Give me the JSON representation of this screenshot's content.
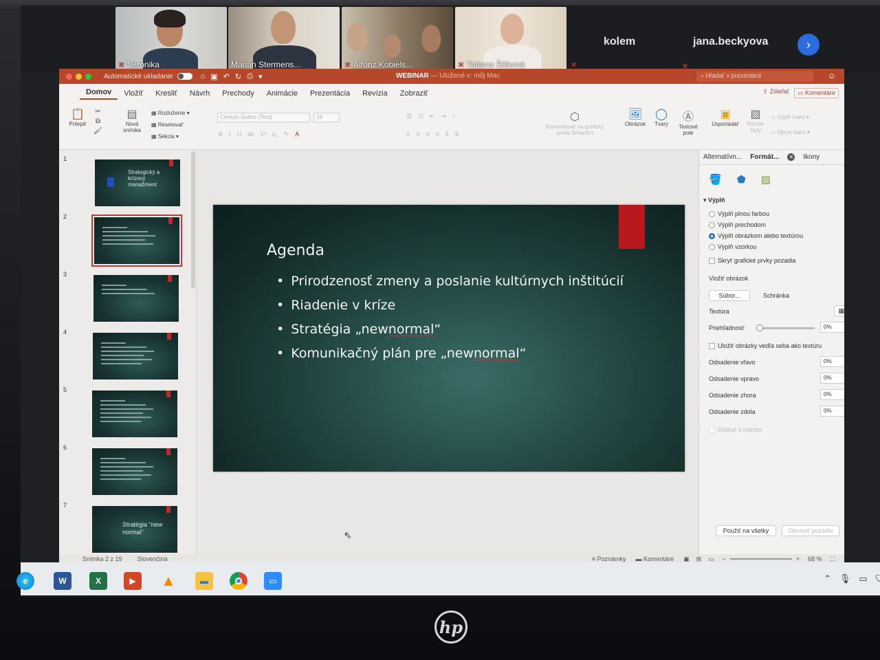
{
  "zoom": {
    "participants": [
      {
        "name": "Veronika",
        "muted": true
      },
      {
        "name": "Marian Stermens...",
        "muted": false
      },
      {
        "name": "Alfonz Kobiels...",
        "muted": true
      },
      {
        "name": "Tatiana Šišková",
        "muted": true
      }
    ],
    "name_only": [
      "kolem",
      "jana.beckyova"
    ],
    "next_icon": "chevron-right-icon",
    "mic_off_icon": "mic-off-icon"
  },
  "ppt": {
    "titlebar": {
      "autosave": "Automatické ukladanie",
      "doc_name": "WEBINAR",
      "doc_status": "— Uložené v: môj Mac",
      "search_placeholder": "Hľadať v prezentácii"
    },
    "menu": [
      "Domov",
      "Vložiť",
      "Kresliť",
      "Návrh",
      "Prechody",
      "Animácie",
      "Prezentácia",
      "Revízia",
      "Zobraziť"
    ],
    "share": "Zdieľať",
    "comments": "Komentáre",
    "ribbon": {
      "paste": "Prilepiť",
      "new_slide": "Nová snímka",
      "layout": "Rozloženie",
      "reset": "Resetovať",
      "section": "Sekcia",
      "font": "Century Gothic (Text)",
      "font_size": "24",
      "smartart": "Konvertovať na grafický prvok SmartArt",
      "picture": "Obrázok",
      "shapes": "Tvary",
      "textbox": "Textové pole",
      "arrange": "Usporiadať",
      "quick_styles": "Rýchle štýly",
      "shape_fill": "Výplň tvaru",
      "shape_outline": "Obrys tvaru"
    },
    "thumbnails": [
      {
        "num": "1",
        "title": "Strategický a krízový manažment"
      },
      {
        "num": "2",
        "title": "Agenda"
      },
      {
        "num": "3",
        "title": "Riadenie v kríze"
      },
      {
        "num": "4",
        "title": "Riadiaci pracovníci musia"
      },
      {
        "num": "5",
        "title": "Čo robiť v kríze?"
      },
      {
        "num": "6",
        "title": "Čo robiť ďalej"
      },
      {
        "num": "7",
        "title": "Stratégia \"new normal\""
      }
    ],
    "selected_thumb": 2,
    "slide": {
      "title": "Agenda",
      "bullets": [
        {
          "text": "Prirodzenosť zmeny a poslanie kultúrnych inštitúcií",
          "wavy": ""
        },
        {
          "text": "Riadenie v kríze",
          "wavy": ""
        },
        {
          "pre": "Stratégia „new ",
          "wavy": "normal",
          "post": "“"
        },
        {
          "pre": "Komunikačný plán pre „new ",
          "wavy": "normal",
          "post": "“"
        }
      ]
    },
    "pane": {
      "tabs": [
        "Alternatívn...",
        "Formát...",
        "Ikony"
      ],
      "fill_header": "Výplň",
      "fill_options": [
        "Výplň plnou farbou",
        "Výplň prechodom",
        "Výplň obrázkom alebo textúrou",
        "Výplň vzorkou"
      ],
      "selected_fill": 2,
      "hide_bg": "Skryť grafické prvky pozadia",
      "insert_picture": "Vložiť obrázok",
      "file_btn": "Súbor...",
      "clipboard_btn": "Schránka",
      "texture": "Textúra",
      "transparency": "Priehľadnosť",
      "transparency_value": "0%",
      "tile": "Uložiť obrázky vedľa seba ako textúru",
      "offsets": [
        {
          "label": "Odsadenie vľavo",
          "value": "0%"
        },
        {
          "label": "Odsadenie vpravo",
          "value": "0%"
        },
        {
          "label": "Odsadenie zhora",
          "value": "0%"
        },
        {
          "label": "Odsadenie zdola",
          "value": "0%"
        }
      ],
      "rotate": "Otáčať s tvarom",
      "apply_all": "Použiť na všetky",
      "reset_bg": "Obnoviť pozadie"
    },
    "status": {
      "slide_of": "Snímka 2 z 19",
      "language": "Slovenčina",
      "notes": "Poznámky",
      "comments": "Komentáre",
      "zoom": "68 %"
    }
  },
  "taskbar": {
    "apps": [
      "edge-icon",
      "word-icon",
      "excel-icon",
      "powerpoint-icon",
      "vlc-icon",
      "file-explorer-icon",
      "chrome-icon",
      "zoom-icon"
    ],
    "word_letter": "W",
    "excel_letter": "X"
  },
  "brand": "hp",
  "colors": {
    "ppt_accent": "#b7472a",
    "slide_red": "#b7191d",
    "zoom_blue": "#2d6cdf"
  }
}
